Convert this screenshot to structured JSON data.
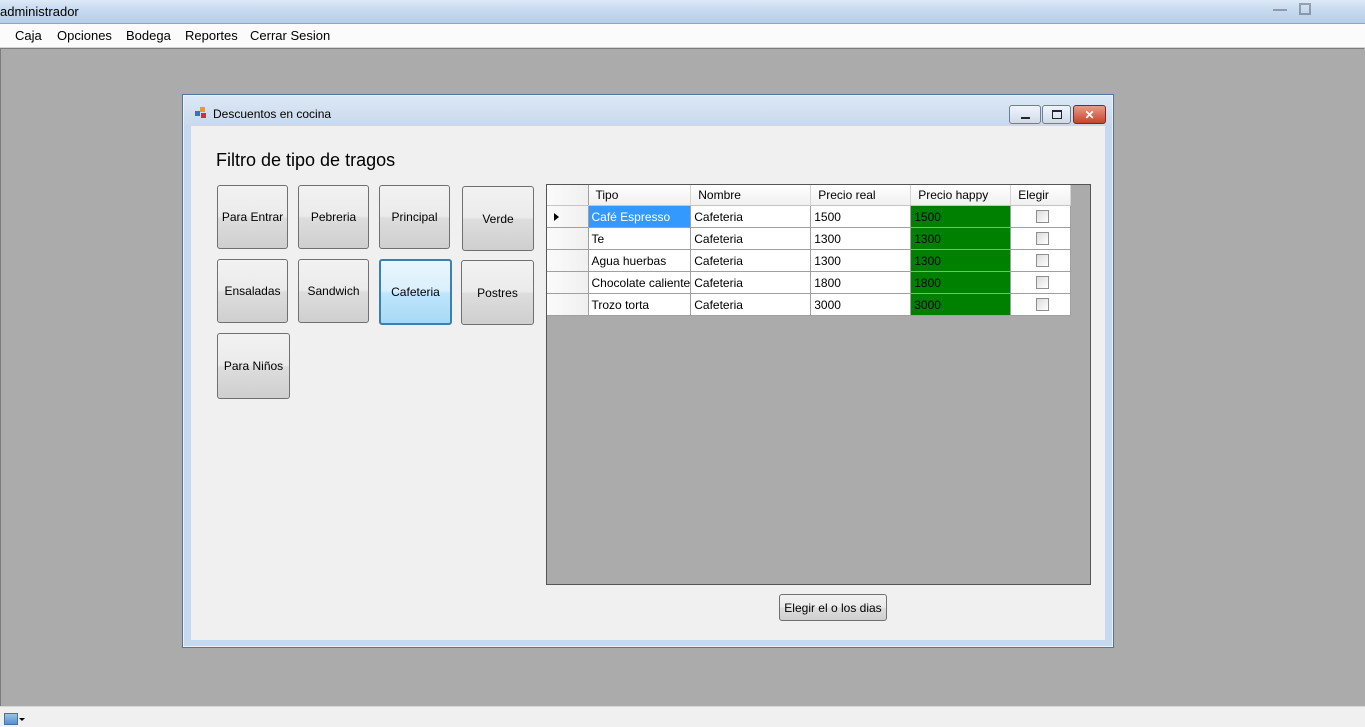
{
  "window": {
    "title": "administrador"
  },
  "menu": {
    "items": [
      "Caja",
      "Opciones",
      "Bodega",
      "Reportes",
      "Cerrar Sesion"
    ]
  },
  "dialog": {
    "title": "Descuentos en cocina",
    "controls": {
      "minimize": "minimize",
      "maximize": "maximize",
      "close": "✕"
    }
  },
  "filter": {
    "heading": "Filtro de tipo de tragos",
    "categories": [
      "Para Entrar",
      "Pebreria",
      "Principal",
      "Verde",
      "Ensaladas",
      "Sandwich",
      "Cafeteria",
      "Postres",
      "Para Niños"
    ],
    "active": "Cafeteria"
  },
  "grid": {
    "columns": [
      "Tipo",
      "Nombre",
      "Precio real",
      "Precio happy",
      "Elegir"
    ],
    "rows": [
      {
        "tipo": "Café Espresso",
        "nombre": "Cafeteria",
        "precio_real": "1500",
        "precio_happy": "1500",
        "elegir": false
      },
      {
        "tipo": "Te",
        "nombre": "Cafeteria",
        "precio_real": "1300",
        "precio_happy": "1300",
        "elegir": false
      },
      {
        "tipo": "Agua huerbas",
        "nombre": "Cafeteria",
        "precio_real": "1300",
        "precio_happy": "1300",
        "elegir": false
      },
      {
        "tipo": "Chocolate caliente",
        "nombre": "Cafeteria",
        "precio_real": "1800",
        "precio_happy": "1800",
        "elegir": false
      },
      {
        "tipo": "Trozo torta",
        "nombre": "Cafeteria",
        "precio_real": "3000",
        "precio_happy": "3000",
        "elegir": false
      }
    ],
    "current_row": 0,
    "happy_color": "#008000",
    "selection_color": "#3399ff"
  },
  "actions": {
    "choose_days": "Elegir el o los dias"
  }
}
